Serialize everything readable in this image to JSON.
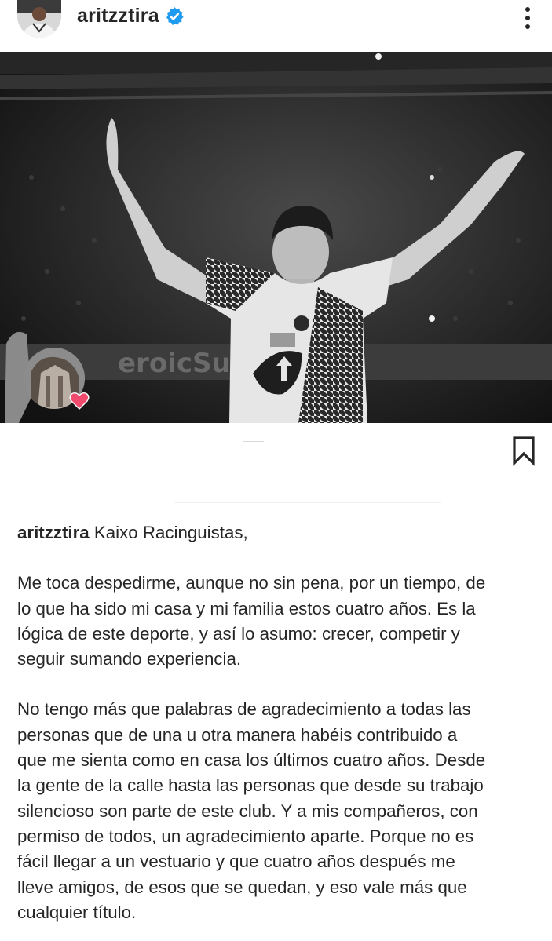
{
  "header": {
    "username": "aritzztira",
    "verified_icon": "verified-badge-icon",
    "more_icon": "more-vertical-icon"
  },
  "post": {
    "photo_description_icon": "photo",
    "music_avatar_icon": "music-avatar",
    "heart_icon": "heart-icon",
    "bookmark_icon": "bookmark-icon"
  },
  "caption": {
    "username": "aritzztira",
    "greeting": "Kaixo Racinguistas,",
    "paragraph1": [
      "Me toca despedirme, aunque no sin pena, por un tiempo, de",
      "lo que ha sido mi casa y mi familia estos cuatro años. Es la",
      "lógica de este deporte, y así lo asumo: crecer, competir y",
      "seguir sumando experiencia."
    ],
    "paragraph2": [
      "No tengo más que palabras de agradecimiento a todas las",
      "personas que de una u otra manera habéis contribuido a",
      "que me sienta como en casa los últimos cuatro años. Desde",
      "la gente de la calle hasta las personas que desde su trabajo",
      "silencioso son parte de este club. Y a mis compañeros, con",
      "permiso de todos, un agradecimiento aparte. Porque no es",
      "fácil llegar a un vestuario y que cuatro años después me",
      "lleve amigos, de esos que se quedan, y eso vale más que",
      "cualquier título."
    ]
  },
  "colors": {
    "text": "#262626",
    "verified": "#1d9bf0",
    "heart": "#f04a6c",
    "background": "#ffffff"
  }
}
